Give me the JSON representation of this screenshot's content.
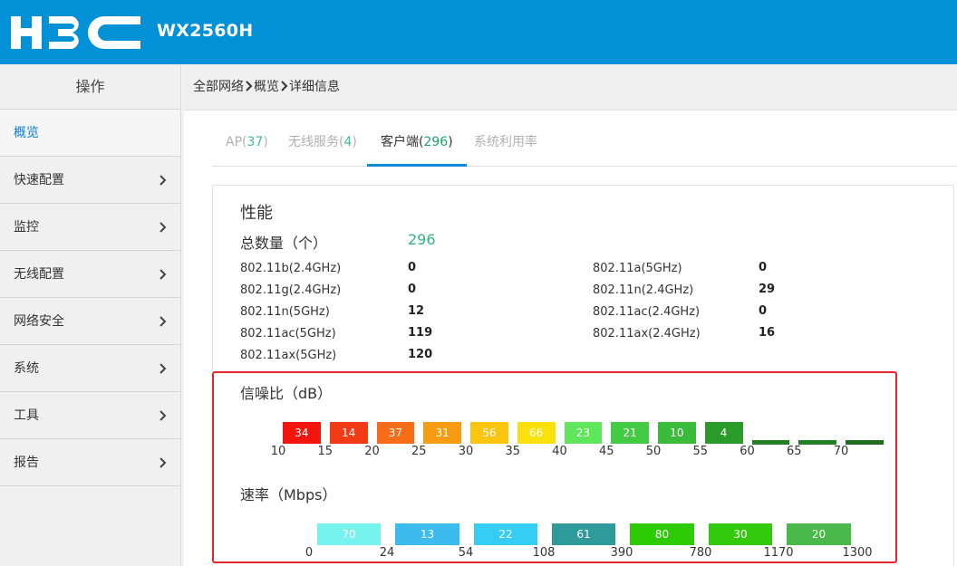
{
  "header": {
    "logo_text": "H3C",
    "model": "WX2560H",
    "bg_color": "#0291d6"
  },
  "sidebar": {
    "title": "操作",
    "items": [
      {
        "label": "概览",
        "active": true,
        "has_chevron": false
      },
      {
        "label": "快速配置",
        "active": false,
        "has_chevron": true
      },
      {
        "label": "监控",
        "active": false,
        "has_chevron": true
      },
      {
        "label": "无线配置",
        "active": false,
        "has_chevron": true
      },
      {
        "label": "网络安全",
        "active": false,
        "has_chevron": true
      },
      {
        "label": "系统",
        "active": false,
        "has_chevron": true
      },
      {
        "label": "工具",
        "active": false,
        "has_chevron": true
      },
      {
        "label": "报告",
        "active": false,
        "has_chevron": true
      }
    ]
  },
  "breadcrumb": [
    "全部网络",
    "概览",
    "详细信息"
  ],
  "tabs": [
    {
      "label": "AP",
      "count": "37",
      "active": false
    },
    {
      "label": "无线服务",
      "count": "4",
      "active": false
    },
    {
      "label": "客户端",
      "count": "296",
      "active": true
    },
    {
      "label": "系统利用率",
      "count": "",
      "active": false
    }
  ],
  "performance": {
    "title": "性能",
    "total_label": "总数量（个）",
    "total_value": "296",
    "left_stats": [
      {
        "label": "802.11b(2.4GHz)",
        "value": "0"
      },
      {
        "label": "802.11g(2.4GHz)",
        "value": "0"
      },
      {
        "label": "802.11n(5GHz)",
        "value": "12"
      },
      {
        "label": "802.11ac(5GHz)",
        "value": "119"
      },
      {
        "label": "802.11ax(5GHz)",
        "value": "120"
      }
    ],
    "right_stats": [
      {
        "label": "802.11a(5GHz)",
        "value": "0"
      },
      {
        "label": "802.11n(2.4GHz)",
        "value": "29"
      },
      {
        "label": "802.11ac(2.4GHz)",
        "value": "0"
      },
      {
        "label": "802.11ax(2.4GHz)",
        "value": "16"
      }
    ]
  },
  "snr": {
    "title": "信噪比（dB）",
    "ticks": [
      "10",
      "15",
      "20",
      "25",
      "30",
      "35",
      "40",
      "45",
      "50",
      "55",
      "60",
      "65",
      "70"
    ],
    "segments": [
      {
        "value": "34",
        "color": "#f2150d"
      },
      {
        "value": "14",
        "color": "#f23a14"
      },
      {
        "value": "37",
        "color": "#f86c1a"
      },
      {
        "value": "31",
        "color": "#f79c11"
      },
      {
        "value": "56",
        "color": "#fbc40f"
      },
      {
        "value": "66",
        "color": "#f9e10c"
      },
      {
        "value": "23",
        "color": "#5fe65a"
      },
      {
        "value": "21",
        "color": "#43cb43"
      },
      {
        "value": "10",
        "color": "#3bbb3b"
      },
      {
        "value": "4",
        "color": "#2a9a2a"
      },
      {
        "value": "",
        "color": "#237f23"
      },
      {
        "value": "",
        "color": "#237f23"
      },
      {
        "value": "",
        "color": "#1f6e1f"
      }
    ]
  },
  "rate": {
    "title": "速率（Mbps）",
    "ticks": [
      "0",
      "24",
      "54",
      "108",
      "390",
      "780",
      "1170",
      "1300"
    ],
    "segments": [
      {
        "value": "70",
        "color": "#76f2ef"
      },
      {
        "value": "13",
        "color": "#3bbcec"
      },
      {
        "value": "22",
        "color": "#36cdf5"
      },
      {
        "value": "61",
        "color": "#2e9a99"
      },
      {
        "value": "80",
        "color": "#2ccb04"
      },
      {
        "value": "30",
        "color": "#33c90d"
      },
      {
        "value": "20",
        "color": "#4ab84a"
      }
    ]
  }
}
